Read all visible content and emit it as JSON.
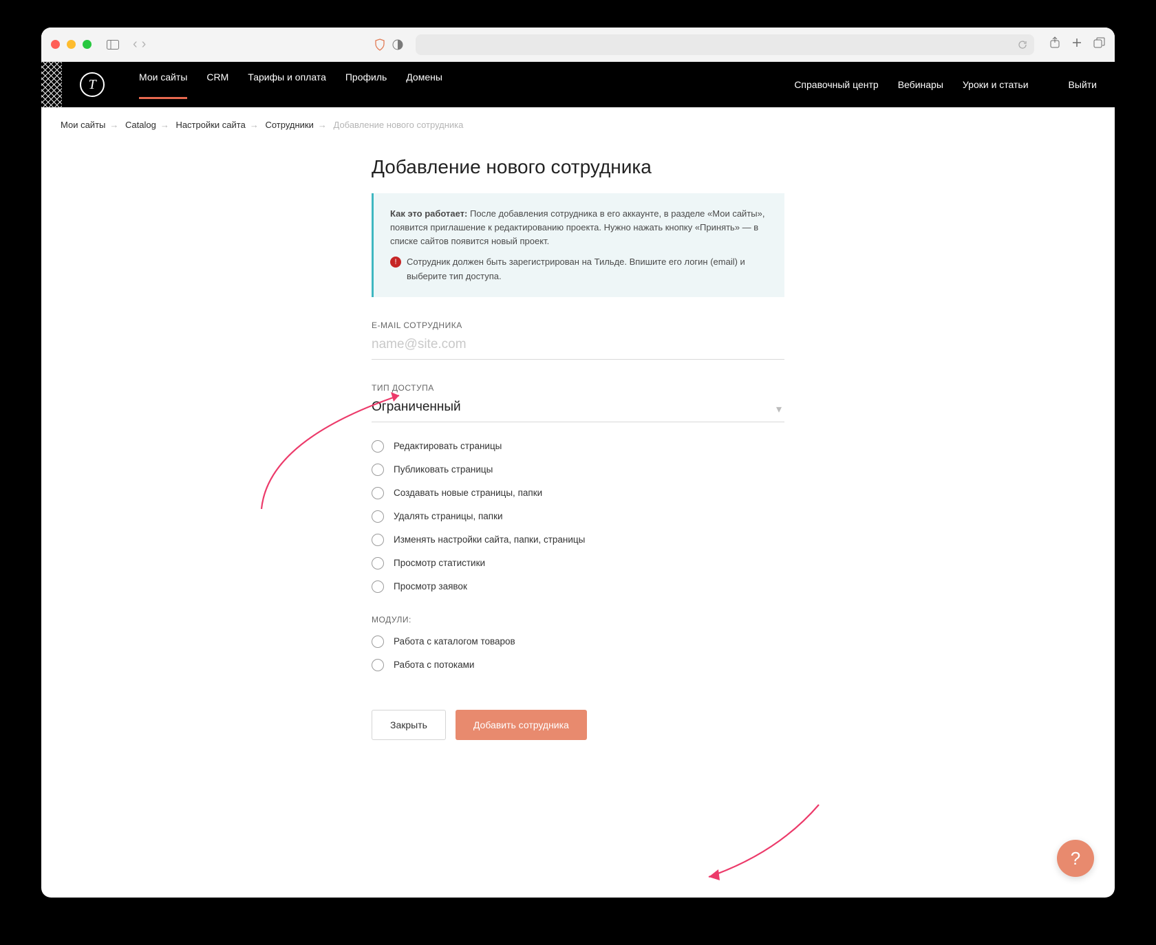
{
  "nav": {
    "links": [
      "Мои сайты",
      "CRM",
      "Тарифы и оплата",
      "Профиль",
      "Домены"
    ],
    "active_index": 0,
    "right": [
      "Справочный центр",
      "Вебинары",
      "Уроки и статьи"
    ],
    "logout": "Выйти"
  },
  "breadcrumbs": {
    "items": [
      "Мои сайты",
      "Catalog",
      "Настройки сайта",
      "Сотрудники"
    ],
    "current": "Добавление нового сотрудника"
  },
  "page": {
    "title": "Добавление нового сотрудника",
    "info_bold": "Как это работает:",
    "info_text": " После добавления сотрудника в его аккаунте, в разделе «Мои сайты», появится приглашение к редактированию проекта. Нужно нажать кнопку «Принять» — в списке сайтов появится новый проект.",
    "warn_text": "Сотрудник должен быть зарегистрирован на Тильде. Впишите его логин (email) и выберите тип доступа."
  },
  "form": {
    "email_label": "E-MAIL СОТРУДНИКА",
    "email_placeholder": "name@site.com",
    "email_value": "",
    "access_label": "ТИП ДОСТУПА",
    "access_value": "Ограниченный",
    "perms": [
      "Редактировать страницы",
      "Публиковать страницы",
      "Создавать новые страницы, папки",
      "Удалять страницы, папки",
      "Изменять настройки сайта, папки, страницы",
      "Просмотр статистики",
      "Просмотр заявок"
    ],
    "modules_label": "МОДУЛИ:",
    "modules": [
      "Работа с каталогом товаров",
      "Работа с потоками"
    ]
  },
  "actions": {
    "close": "Закрыть",
    "submit": "Добавить сотрудника"
  },
  "help_glyph": "?"
}
